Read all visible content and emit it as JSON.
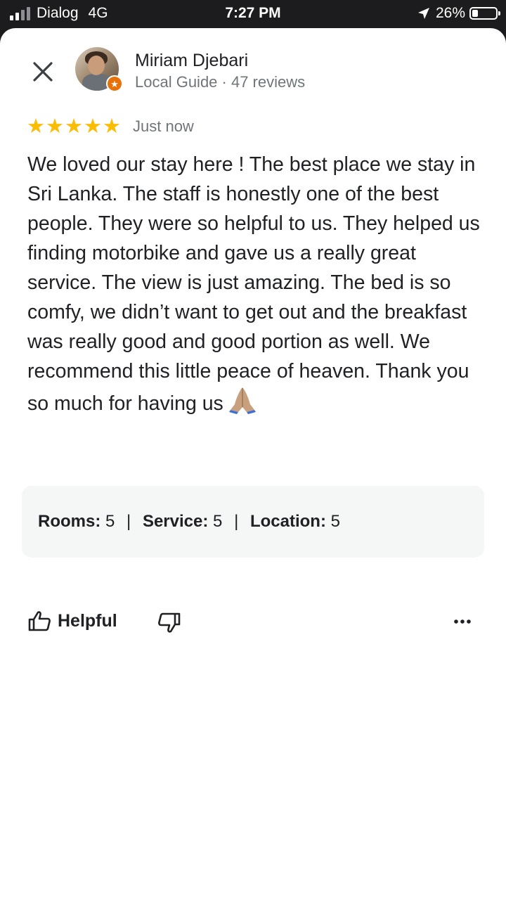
{
  "status_bar": {
    "carrier": "Dialog",
    "network": "4G",
    "time": "7:27 PM",
    "battery": "26%",
    "battery_level": 0.26
  },
  "review": {
    "close_icon": "close-icon",
    "author": {
      "name": "Miriam Djebari",
      "meta": "Local Guide · 47 reviews"
    },
    "rating": 5,
    "date": "Just now",
    "text": "We loved our stay here ! The best place we stay in Sri Lanka. The staff is honestly one of the best people. They were so helpful to us. They helped us finding motorbike and gave us a really great service. The view is just amazing. The bed is so comfy, we didn’t want to get out and the breakfast was really good and good portion as well. We recommend this little peace of heaven. Thank you so much for having us",
    "sub_ratings": [
      {
        "label": "Rooms:",
        "value": "5"
      },
      {
        "label": "Service:",
        "value": "5"
      },
      {
        "label": "Location:",
        "value": "5"
      }
    ]
  },
  "actions": {
    "helpful_label": "Helpful",
    "helpful_icon": "thumbs-up-icon",
    "dislike_icon": "thumbs-down-icon",
    "more_icon": "more-horizontal-icon"
  },
  "colors": {
    "star": "#fbbc04",
    "badge": "#e8710a",
    "text": "#202124",
    "secondary": "#70757a",
    "panel": "#f5f6f6"
  }
}
